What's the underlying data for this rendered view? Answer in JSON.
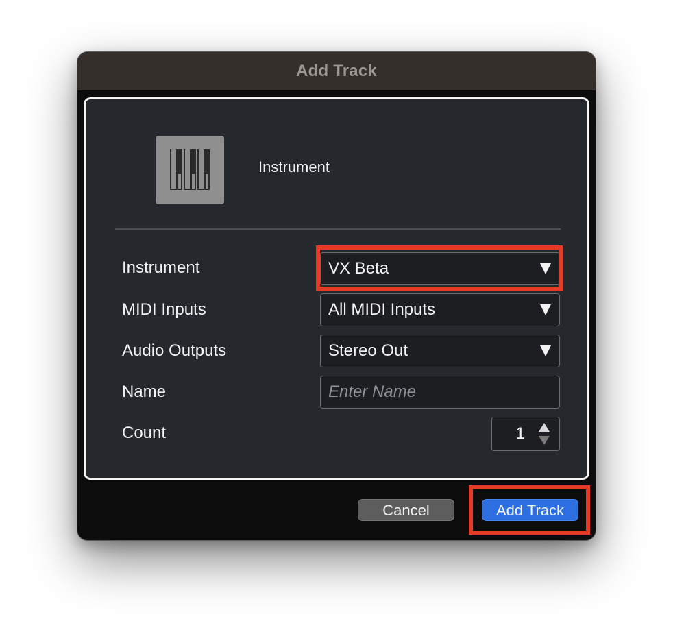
{
  "dialog": {
    "title": "Add Track"
  },
  "track_type": {
    "label": "Instrument",
    "icon": "piano-keys-icon"
  },
  "form": {
    "instrument": {
      "label": "Instrument",
      "value": "VX Beta"
    },
    "midi_inputs": {
      "label": "MIDI Inputs",
      "value": "All MIDI Inputs"
    },
    "audio_outputs": {
      "label": "Audio Outputs",
      "value": "Stereo Out"
    },
    "name": {
      "label": "Name",
      "placeholder": "Enter Name"
    },
    "count": {
      "label": "Count",
      "value": "1"
    }
  },
  "buttons": {
    "cancel": "Cancel",
    "add": "Add Track"
  },
  "colors": {
    "highlight": "#e53a25",
    "primary_button": "#2d6fe0",
    "panel_background": "#25282c",
    "title_bar": "#352f2c"
  }
}
